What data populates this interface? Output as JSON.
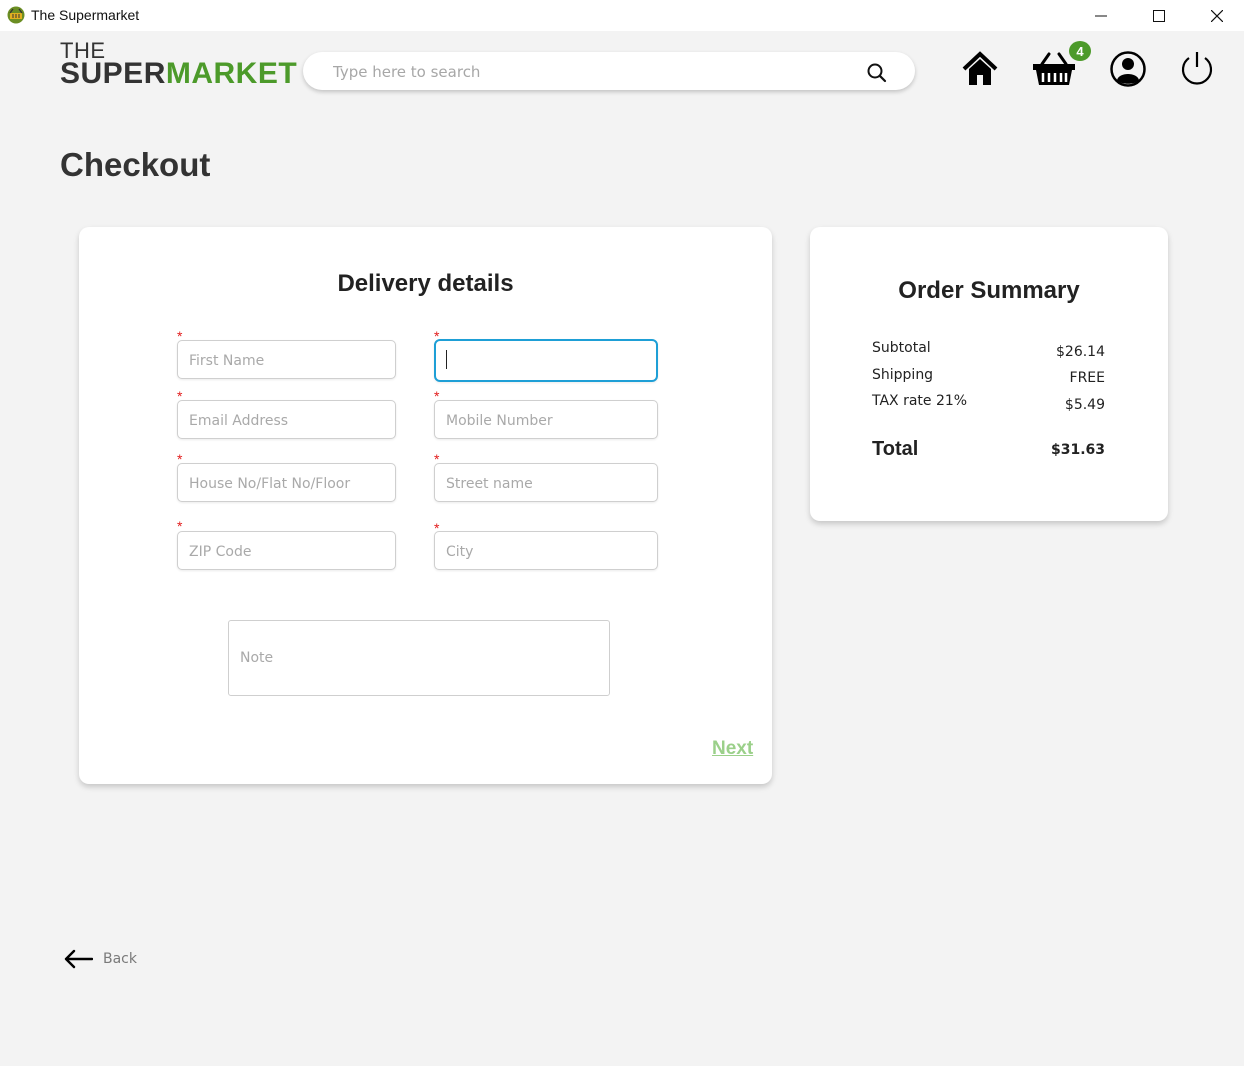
{
  "window": {
    "title": "The Supermarket"
  },
  "header": {
    "logo_the": "THE",
    "logo_super": "SUPER",
    "logo_market": "MARKET",
    "search_placeholder": "Type here to search",
    "cart_count": "4",
    "brand_color": "#4c9a2a",
    "icons": [
      "search-icon",
      "home-icon",
      "basket-icon",
      "user-icon",
      "power-icon"
    ]
  },
  "page": {
    "title": "Checkout"
  },
  "delivery": {
    "heading": "Delivery details",
    "required_marker": "*",
    "fields": {
      "first_name": "First Name",
      "last_name": "",
      "email": "Email Address",
      "mobile": "Mobile Number",
      "house": "House No/Flat No/Floor",
      "street": "Street name",
      "zip": "ZIP Code",
      "city": "City"
    },
    "note_placeholder": "Note",
    "next_label": "Next"
  },
  "summary": {
    "heading": "Order Summary",
    "subtotal_label": "Subtotal",
    "subtotal_value": "$26.14",
    "shipping_label": "Shipping",
    "shipping_value": "FREE",
    "tax_label": "TAX rate 21%",
    "tax_value": "$5.49",
    "total_label": "Total",
    "total_value": "$31.63"
  },
  "nav": {
    "back_label": "Back"
  }
}
